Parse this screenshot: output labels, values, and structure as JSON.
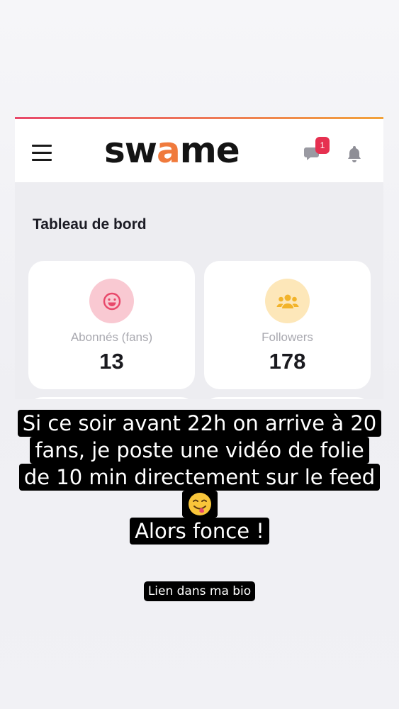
{
  "app": {
    "logo_text": "swame",
    "logo_parts": [
      "sw",
      "a",
      "me"
    ],
    "accent_colors": [
      "#e8486a",
      "#f2a23a"
    ],
    "notification_count": "1",
    "icons": [
      "menu-icon",
      "chat-icon",
      "bell-icon",
      "smiley-icon",
      "group-icon"
    ]
  },
  "dashboard": {
    "title": "Tableau de bord",
    "cards": [
      {
        "label": "Abonnés (fans)",
        "value": "13",
        "icon": "smiley-icon",
        "icon_bg": "#f9c9d2",
        "icon_color": "#e8486a"
      },
      {
        "label": "Followers",
        "value": "178",
        "icon": "group-icon",
        "icon_bg": "#fde7b9",
        "icon_color": "#f2b32a"
      }
    ]
  },
  "story": {
    "lines": [
      "Si ce soir avant 22h on arrive à 20",
      "fans, je poste une vidéo de folie",
      "de 10 min directement sur le feed"
    ],
    "emoji": "😋",
    "cta": "Alors fonce !",
    "bio_link": "Lien dans ma bio"
  }
}
